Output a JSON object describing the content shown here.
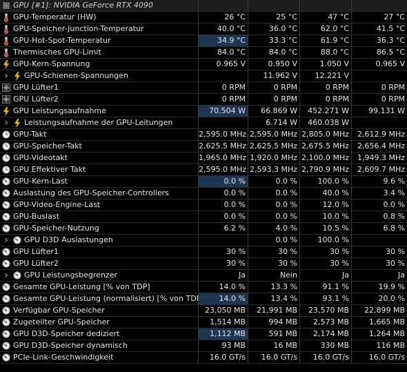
{
  "header": {
    "title": "GPU [#1]: NVIDIA GeForce RTX 4090"
  },
  "rows": [
    {
      "label": "GPU-Temperatur (HW)",
      "icon": "thermometer-icon",
      "vals": [
        "26 °C",
        "25 °C",
        "47 °C",
        "27 °C"
      ]
    },
    {
      "label": "GPU-Speicher-Junction-Temperatur",
      "icon": "thermometer-icon",
      "vals": [
        "40.0 °C",
        "36.0 °C",
        "62.0 °C",
        "41.5 °C"
      ]
    },
    {
      "label": "GPU-Hot-Spot-Temperatur",
      "icon": "thermometer-icon",
      "vals": [
        "34.9 °C",
        "33.3 °C",
        "61.9 °C",
        "36.3 °C"
      ],
      "hl": true
    },
    {
      "label": "Thermisches GPU-Limit",
      "icon": "thermometer-icon",
      "vals": [
        "84.0 °C",
        "84.0 °C",
        "88.0 °C",
        "86.5 °C"
      ]
    },
    {
      "label": "GPU-Kern-Spannung",
      "icon": "lightning-icon",
      "vals": [
        "0.965 V",
        "0.950 V",
        "1.050 V",
        "0.965 V"
      ]
    },
    {
      "label": "GPU-Schienen-Spannungen",
      "icon": "lightning-icon",
      "expander": true,
      "vals": [
        "",
        "11.962 V",
        "12.221 V",
        ""
      ]
    },
    {
      "label": "GPU Lüfter1",
      "icon": "fan-icon",
      "vals": [
        "0 RPM",
        "0 RPM",
        "0 RPM",
        "0 RPM"
      ]
    },
    {
      "label": "GPU Lüfter2",
      "icon": "fan-icon",
      "vals": [
        "0 RPM",
        "0 RPM",
        "0 RPM",
        "0 RPM"
      ]
    },
    {
      "label": "GPU Leistungsaufnahme",
      "icon": "lightning-icon",
      "vals": [
        "70.504 W",
        "66.869 W",
        "452.271 W",
        "99.131 W"
      ],
      "hl": true
    },
    {
      "label": "Leistungsaufnahme der GPU-Leitungen",
      "icon": "lightning-icon",
      "expander": true,
      "vals": [
        "",
        "6.714 W",
        "460.038 W",
        ""
      ]
    },
    {
      "label": "GPU-Takt",
      "icon": "clock-icon",
      "vals": [
        "2,595.0 MHz",
        "2,595.0 MHz",
        "2,805.0 MHz",
        "2,612.9 MHz"
      ]
    },
    {
      "label": "GPU-Speicher-Takt",
      "icon": "clock-icon",
      "vals": [
        "2,625.5 MHz",
        "2,625.5 MHz",
        "2,675.5 MHz",
        "2,656.4 MHz"
      ]
    },
    {
      "label": "GPU-Videotakt",
      "icon": "clock-icon",
      "vals": [
        "1,965.0 MHz",
        "1,920.0 MHz",
        "2,100.0 MHz",
        "1,949.3 MHz"
      ]
    },
    {
      "label": "GPU Effektiver Takt",
      "icon": "clock-icon",
      "vals": [
        "2,595.0 MHz",
        "2,593.3 MHz",
        "2,790.9 MHz",
        "2,609.7 MHz"
      ]
    },
    {
      "label": "GPU-Kern-Last",
      "icon": "gauge-icon",
      "vals": [
        "0.0 %",
        "0.0 %",
        "100.0 %",
        "9.6 %"
      ],
      "hl": true
    },
    {
      "label": "Auslastung des GPU-Speicher-Controllers",
      "icon": "gauge-icon",
      "vals": [
        "0.0 %",
        "0.0 %",
        "40.0 %",
        "3.4 %"
      ]
    },
    {
      "label": "GPU-Video-Engine-Last",
      "icon": "gauge-icon",
      "vals": [
        "0.0 %",
        "0.0 %",
        "12.0 %",
        "0.0 %"
      ]
    },
    {
      "label": "GPU-Buslast",
      "icon": "gauge-icon",
      "vals": [
        "0.0 %",
        "0.0 %",
        "10.0 %",
        "0.8 %"
      ]
    },
    {
      "label": "GPU-Speicher-Nutzung",
      "icon": "gauge-icon",
      "vals": [
        "6.2 %",
        "4.0 %",
        "10.5 %",
        "6.8 %"
      ]
    },
    {
      "label": "GPU D3D Auslastungen",
      "icon": "gauge-icon",
      "expander": true,
      "vals": [
        "",
        "0.0 %",
        "100.0 %",
        ""
      ]
    },
    {
      "label": "GPU Lüfter1",
      "icon": "gauge-icon",
      "vals": [
        "30 %",
        "30 %",
        "30 %",
        "30 %"
      ]
    },
    {
      "label": "GPU Lüfter2",
      "icon": "gauge-icon",
      "vals": [
        "30 %",
        "30 %",
        "30 %",
        "30 %"
      ]
    },
    {
      "label": "GPU Leistungsbegrenzer",
      "icon": "gauge-icon",
      "expander": true,
      "vals": [
        "Ja",
        "Nein",
        "Ja",
        "Ja"
      ]
    },
    {
      "label": "Gesamte GPU-Leistung [% von TDP]",
      "icon": "gauge-icon",
      "vals": [
        "14.0 %",
        "13.3 %",
        "91.1 %",
        "19.9 %"
      ]
    },
    {
      "label": "Gesamte GPU-Leistung (normalisiert) [% von TDP]",
      "icon": "gauge-icon",
      "vals": [
        "14.0 %",
        "13.4 %",
        "93.1 %",
        "20.0 %"
      ],
      "hl": true
    },
    {
      "label": "Verfügbar GPU-Speicher",
      "icon": "gauge-icon",
      "vals": [
        "23,050 MB",
        "21,991 MB",
        "23,570 MB",
        "22,899 MB"
      ]
    },
    {
      "label": "Zugeteilter GPU-Speicher",
      "icon": "gauge-icon",
      "vals": [
        "1,514 MB",
        "994 MB",
        "2,573 MB",
        "1,665 MB"
      ]
    },
    {
      "label": "GPU D3D-Speicher dediziert",
      "icon": "gauge-icon",
      "vals": [
        "1,112 MB",
        "591 MB",
        "2,174 MB",
        "1,264 MB"
      ],
      "hl": true
    },
    {
      "label": "GPU D3D-Speicher dynamisch",
      "icon": "gauge-icon",
      "vals": [
        "93 MB",
        "16 MB",
        "330 MB",
        "116 MB"
      ]
    },
    {
      "label": "PCIe-Link-Geschwindigkeit",
      "icon": "gauge-icon",
      "vals": [
        "16.0 GT/s",
        "16.0 GT/s",
        "16.0 GT/s",
        "16.0 GT/s"
      ]
    }
  ]
}
